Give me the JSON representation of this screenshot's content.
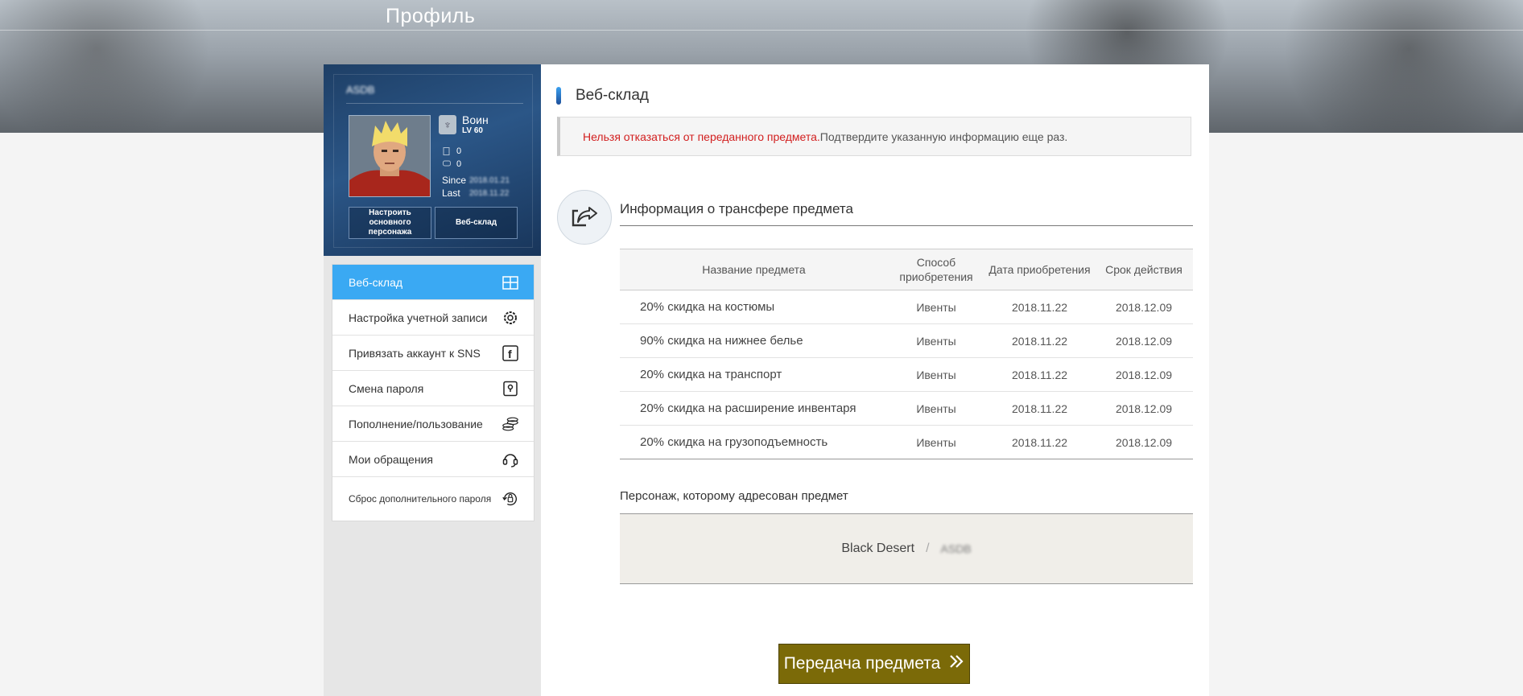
{
  "header": {
    "title": "Профиль"
  },
  "profile": {
    "name": "ASDB",
    "class_name": "Воин",
    "level": "LV 60",
    "stat1": "0",
    "stat2": "0",
    "since_label": "Since",
    "since_value": "2018.01.21",
    "last_label": "Last",
    "last_value": "2018.11.22",
    "btn_main_char": "Настроить основного персонажа",
    "btn_web_storage": "Веб-склад"
  },
  "menu": {
    "items": [
      {
        "label": "Веб-склад",
        "icon": "storage-icon"
      },
      {
        "label": "Настройка учетной записи",
        "icon": "gear-icon"
      },
      {
        "label": "Привязать аккаунт к SNS",
        "icon": "facebook-icon"
      },
      {
        "label": "Смена пароля",
        "icon": "lock-icon"
      },
      {
        "label": "Пополнение/пользование",
        "icon": "coins-icon"
      },
      {
        "label": "Мои обращения",
        "icon": "headset-icon"
      },
      {
        "label": "Сброс дополнительного пароля",
        "icon": "reset-lock-icon"
      }
    ]
  },
  "main": {
    "title": "Веб-склад",
    "notice_red": "Нельзя отказаться от переданного предмета.",
    "notice_rest": "Подтвердите указанную информацию еще раз.",
    "transfer_title": "Информация о трансфере предмета",
    "table": {
      "headers": [
        "Название предмета",
        "Способ приобретения",
        "Дата приобретения",
        "Срок действия"
      ],
      "rows": [
        [
          "20% скидка на костюмы",
          "Ивенты",
          "2018.11.22",
          "2018.12.09"
        ],
        [
          "90% скидка на нижнее белье",
          "Ивенты",
          "2018.11.22",
          "2018.12.09"
        ],
        [
          "20% скидка на транспорт",
          "Ивенты",
          "2018.11.22",
          "2018.12.09"
        ],
        [
          "20% скидка на расширение инвентаря",
          "Ивенты",
          "2018.11.22",
          "2018.12.09"
        ],
        [
          "20% скидка на грузоподъемность",
          "Ивенты",
          "2018.11.22",
          "2018.12.09"
        ]
      ]
    },
    "recipient_label": "Персонаж, которому адресован предмет",
    "recipient_game": "Black Desert",
    "recipient_sep": "/",
    "recipient_char": "ASDB",
    "submit_label": "Передача предмета"
  },
  "colors": {
    "active_menu": "#3aa9f3",
    "submit_bg": "#7b6a08",
    "notice_red": "#d21f1f"
  }
}
